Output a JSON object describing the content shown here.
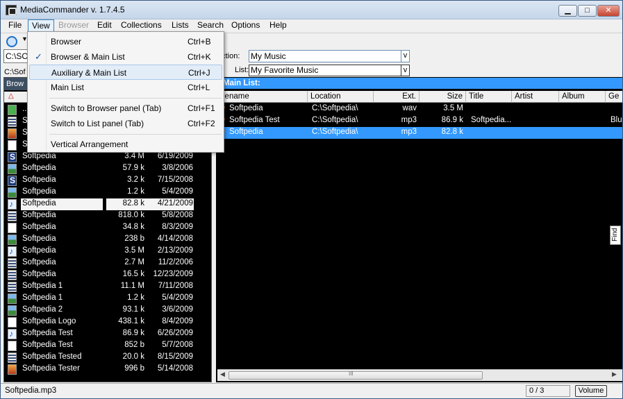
{
  "window": {
    "title": "MediaCommander v. 1.7.4.5",
    "controls": {
      "minimize": "▁",
      "maximize": "□",
      "close": "✕"
    }
  },
  "menubar": [
    {
      "label": "File",
      "state": "normal"
    },
    {
      "label": "View",
      "state": "active"
    },
    {
      "label": "Browser",
      "state": "disabled"
    },
    {
      "label": "Edit",
      "state": "normal"
    },
    {
      "label": "Collections",
      "state": "normal"
    },
    {
      "label": "Lists",
      "state": "normal"
    },
    {
      "label": "Search",
      "state": "normal"
    },
    {
      "label": "Options",
      "state": "normal"
    },
    {
      "label": "Help",
      "state": "normal"
    }
  ],
  "view_menu": {
    "items": [
      {
        "label": "Browser",
        "shortcut": "Ctrl+B",
        "checked": false
      },
      {
        "label": "Browser & Main List",
        "shortcut": "Ctrl+K",
        "checked": true
      },
      {
        "label": "Auxiliary & Main List",
        "shortcut": "Ctrl+J",
        "checked": false,
        "highlighted": true
      },
      {
        "label": "Main List",
        "shortcut": "Ctrl+L",
        "checked": false
      },
      {
        "label": "Switch to Browser panel (Tab)",
        "shortcut": "Ctrl+F1",
        "checked": false
      },
      {
        "label": "Switch to List panel (Tab)",
        "shortcut": "Ctrl+F2",
        "checked": false
      },
      {
        "label": "Vertical Arrangement",
        "shortcut": "",
        "checked": false
      }
    ],
    "check_mark": "✓"
  },
  "toolbar": {
    "dropdown_arrow": "▼"
  },
  "browser": {
    "path_value": "C:\\SO",
    "path_label": "C:\\Sof",
    "panel_header": "Brow",
    "sort_indicator": "△",
    "files": [
      {
        "icon": "green",
        "name": "..",
        "size": "",
        "date": ""
      },
      {
        "icon": "film",
        "name": "Sof",
        "size": "",
        "date": ""
      },
      {
        "icon": "orange",
        "name": "Sof",
        "size": "",
        "date": ""
      },
      {
        "icon": "doc",
        "name": "Sof",
        "size": "",
        "date": ""
      },
      {
        "icon": "s",
        "name": "Softpedia",
        "size": "3.4 M",
        "date": "6/19/2009"
      },
      {
        "icon": "img",
        "name": "Softpedia",
        "size": "57.9 k",
        "date": "3/8/2006"
      },
      {
        "icon": "s",
        "name": "Softpedia",
        "size": "3.2 k",
        "date": "7/15/2008"
      },
      {
        "icon": "img",
        "name": "Softpedia",
        "size": "1.2 k",
        "date": "5/4/2009"
      },
      {
        "icon": "note",
        "name": "Softpedia",
        "size": "82.8 k",
        "date": "4/21/2009",
        "selected": true
      },
      {
        "icon": "film",
        "name": "Softpedia",
        "size": "818.0 k",
        "date": "5/8/2008"
      },
      {
        "icon": "doc",
        "name": "Softpedia",
        "size": "34.8 k",
        "date": "8/3/2009"
      },
      {
        "icon": "img",
        "name": "Softpedia",
        "size": "238 b",
        "date": "4/14/2008"
      },
      {
        "icon": "note",
        "name": "Softpedia",
        "size": "3.5 M",
        "date": "2/13/2009"
      },
      {
        "icon": "film",
        "name": "Softpedia",
        "size": "2.7 M",
        "date": "11/2/2006"
      },
      {
        "icon": "film",
        "name": "Softpedia",
        "size": "16.5 k",
        "date": "12/23/2009"
      },
      {
        "icon": "film",
        "name": "Softpedia 1",
        "size": "11.1 M",
        "date": "7/11/2008"
      },
      {
        "icon": "img",
        "name": "Softpedia 1",
        "size": "1.2 k",
        "date": "5/4/2009"
      },
      {
        "icon": "img",
        "name": "Softpedia 2",
        "size": "93.1 k",
        "date": "3/6/2009"
      },
      {
        "icon": "doc",
        "name": "Softpedia Logo",
        "size": "438.1 k",
        "date": "8/4/2009"
      },
      {
        "icon": "note",
        "name": "Softpedia Test",
        "size": "86.9 k",
        "date": "6/26/2009"
      },
      {
        "icon": "doc",
        "name": "Softpedia Test",
        "size": "852 b",
        "date": "5/7/2008"
      },
      {
        "icon": "film",
        "name": "Softpedia Tested",
        "size": "20.0 k",
        "date": "8/15/2009"
      },
      {
        "icon": "orange",
        "name": "Softpedia Tester",
        "size": "996 b",
        "date": "5/14/2008"
      }
    ]
  },
  "collection": {
    "label": "ection:",
    "value": "My Music",
    "drop": "v"
  },
  "list": {
    "label": "List:",
    "value": "My Favorite Music",
    "drop": "v"
  },
  "main_list": {
    "header": "Main List:",
    "columns": [
      "lename",
      "Location",
      "Ext.",
      "Size",
      "Title",
      "Artist",
      "Album",
      "Ge"
    ],
    "rows": [
      {
        "name": "Softpedia",
        "location": "C:\\Softpedia\\",
        "ext": "wav",
        "size": "3.5 M",
        "title": "",
        "artist": "",
        "album": "",
        "genre": ""
      },
      {
        "name": "Softpedia Test",
        "location": "C:\\Softpedia\\",
        "ext": "mp3",
        "size": "86.9 k",
        "title": "Softpedia...",
        "artist": "",
        "album": "",
        "genre": "Blu"
      },
      {
        "name": "Softpedia",
        "location": "C:\\Softpedia\\",
        "ext": "mp3",
        "size": "82.8 k",
        "title": "",
        "artist": "",
        "album": "",
        "genre": "",
        "selected": true
      }
    ],
    "find_tab": "Find",
    "scroll_thumb_grip": "III"
  },
  "statusbar": {
    "filename": "Softpedia.mp3",
    "count": "0 / 3",
    "volume": "Volume"
  }
}
